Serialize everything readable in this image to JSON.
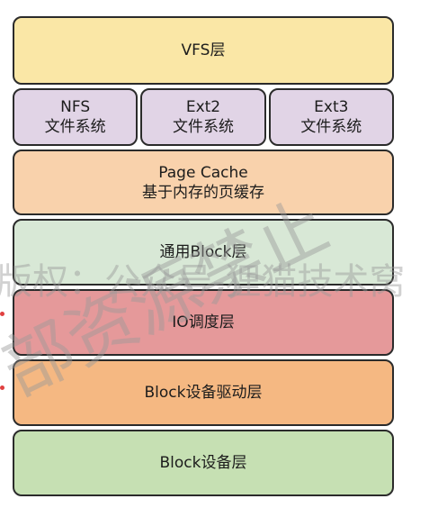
{
  "layers": {
    "vfs": "VFS层",
    "filesystems": [
      {
        "name": "NFS",
        "label": "文件系统"
      },
      {
        "name": "Ext2",
        "label": "文件系统"
      },
      {
        "name": "Ext3",
        "label": "文件系统"
      }
    ],
    "page_cache": {
      "title": "Page Cache",
      "subtitle": "基于内存的页缓存"
    },
    "generic_block": "通用Block层",
    "io_scheduler": "IO调度层",
    "block_driver": "Block设备驱动层",
    "block_device": "Block设备层"
  },
  "watermark": {
    "line1": "版权：公众号-狸猫技术窝",
    "line2": "部资源禁止"
  },
  "colors": {
    "vfs": "#fae7a6",
    "filesystem": "#e1d4e6",
    "page_cache": "#f9d2ac",
    "generic_block": "#d8e8d6",
    "io_scheduler": "#e5999a",
    "block_driver": "#f5b882",
    "block_device": "#c6e0b3"
  }
}
